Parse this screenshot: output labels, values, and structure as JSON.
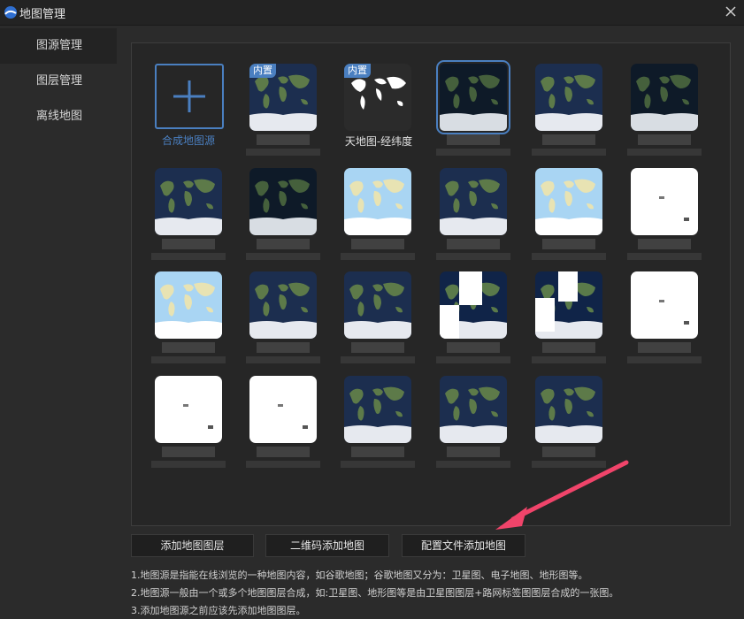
{
  "window": {
    "title": "地图管理"
  },
  "sidebar": {
    "items": [
      {
        "label": "图源管理",
        "active": true
      },
      {
        "label": "图层管理",
        "active": false
      },
      {
        "label": "离线地图",
        "active": false
      }
    ]
  },
  "grid": {
    "add_label": "合成地图源",
    "badge": "内置",
    "tianditu_label": "天地图-经纬度",
    "tile_styles": [
      "satellite",
      "tianditu",
      "satellite-dark",
      "satellite",
      "satellite-dark",
      "satellite",
      "satellite-dark",
      "light",
      "satellite",
      "light",
      "white",
      "light",
      "satellite",
      "satellite",
      "patch",
      "patch",
      "white",
      "white",
      "white",
      "satellite",
      "satellite",
      "satellite"
    ]
  },
  "buttons": {
    "add_layer": "添加地图图层",
    "qr_add": "二维码添加地图",
    "config_add": "配置文件添加地图"
  },
  "notes": [
    "1.地图源是指能在线浏览的一种地图内容，如谷歌地图；谷歌地图又分为：卫星图、电子地图、地形图等。",
    "2.地图源一般由一个或多个地图图层合成，如:卫星图、地形图等是由卫星图图层+路网标签图图层合成的一张图。",
    "3.添加地图源之前应该先添加地图图层。"
  ],
  "colors": {
    "accent": "#4a7fc0",
    "background": "#2b2b2b",
    "arrow": "#f0446a"
  }
}
